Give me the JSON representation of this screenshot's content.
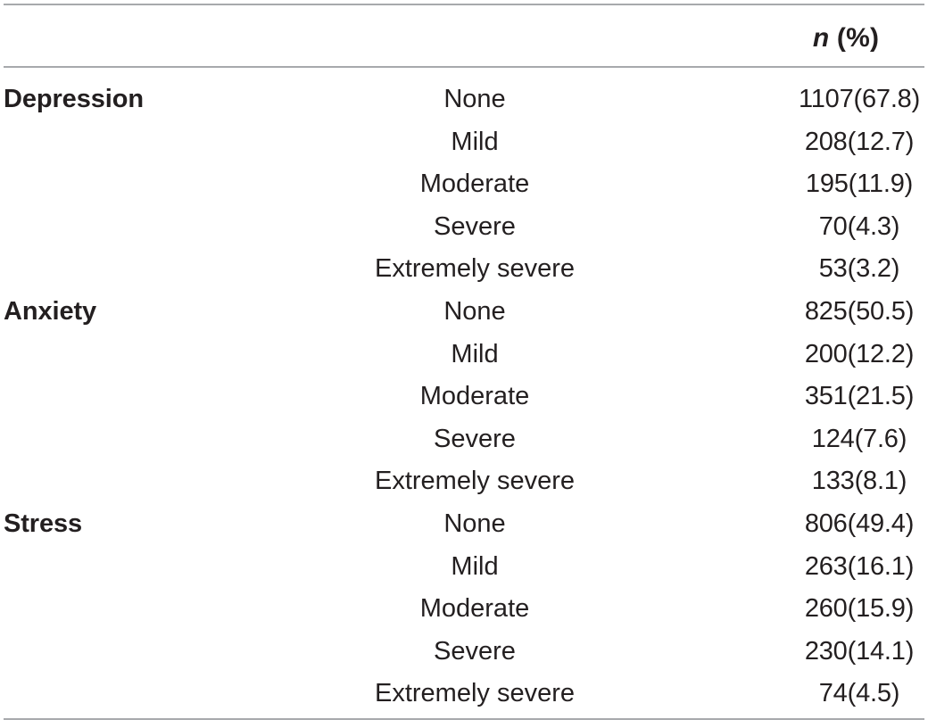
{
  "table": {
    "columns": {
      "group_header": "",
      "category_header": "",
      "value_header_symbol": "n",
      "value_header_suffix": " (%)"
    },
    "rows": [
      {
        "group": "Depression",
        "category": "None",
        "value": "1107(67.8)"
      },
      {
        "group": "",
        "category": "Mild",
        "value": "208(12.7)"
      },
      {
        "group": "",
        "category": "Moderate",
        "value": "195(11.9)"
      },
      {
        "group": "",
        "category": "Severe",
        "value": "70(4.3)"
      },
      {
        "group": "",
        "category": "Extremely severe",
        "value": "53(3.2)"
      },
      {
        "group": "Anxiety",
        "category": "None",
        "value": "825(50.5)"
      },
      {
        "group": "",
        "category": "Mild",
        "value": "200(12.2)"
      },
      {
        "group": "",
        "category": "Moderate",
        "value": "351(21.5)"
      },
      {
        "group": "",
        "category": "Severe",
        "value": "124(7.6)"
      },
      {
        "group": "",
        "category": "Extremely severe",
        "value": "133(8.1)"
      },
      {
        "group": "Stress",
        "category": "None",
        "value": "806(49.4)"
      },
      {
        "group": "",
        "category": "Mild",
        "value": "263(16.1)"
      },
      {
        "group": "",
        "category": "Moderate",
        "value": "260(15.9)"
      },
      {
        "group": "",
        "category": "Severe",
        "value": "230(14.1)"
      },
      {
        "group": "",
        "category": "Extremely severe",
        "value": "74(4.5)"
      }
    ],
    "colors": {
      "text": "#231f20",
      "rule": "#a7a9ac",
      "background": "#ffffff"
    }
  },
  "chart_data": {
    "type": "table",
    "title": "",
    "columns": [
      "",
      "",
      "n (%)"
    ],
    "groups": [
      {
        "name": "Depression",
        "categories": [
          "None",
          "Mild",
          "Moderate",
          "Severe",
          "Extremely severe"
        ],
        "counts": [
          1107,
          208,
          195,
          70,
          53
        ],
        "percents": [
          67.8,
          12.7,
          11.9,
          4.3,
          3.2
        ]
      },
      {
        "name": "Anxiety",
        "categories": [
          "None",
          "Mild",
          "Moderate",
          "Severe",
          "Extremely severe"
        ],
        "counts": [
          825,
          200,
          351,
          124,
          133
        ],
        "percents": [
          50.5,
          12.2,
          21.5,
          7.6,
          8.1
        ]
      },
      {
        "name": "Stress",
        "categories": [
          "None",
          "Mild",
          "Moderate",
          "Severe",
          "Extremely severe"
        ],
        "counts": [
          806,
          263,
          260,
          230,
          74
        ],
        "percents": [
          49.4,
          16.1,
          15.9,
          14.1,
          4.5
        ]
      }
    ]
  }
}
